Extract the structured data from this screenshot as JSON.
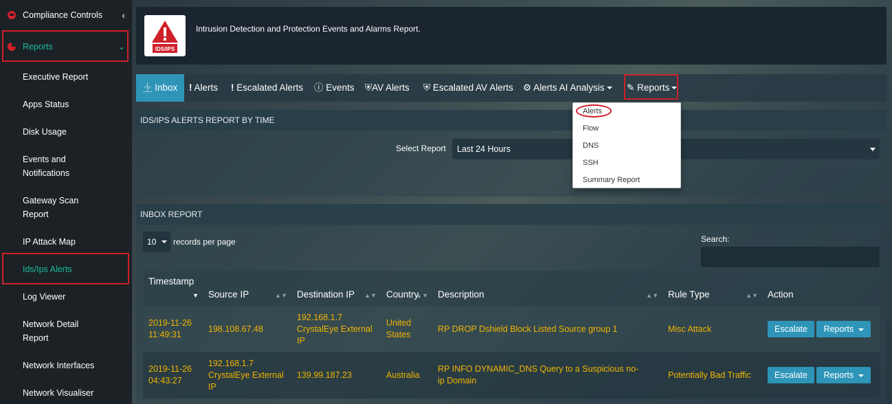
{
  "sidebar": {
    "compliance": "Compliance Controls",
    "reports": "Reports",
    "items": [
      {
        "label": "Executive Report"
      },
      {
        "label": "Apps Status"
      },
      {
        "label": "Disk Usage"
      },
      {
        "label": "Events and Notifications"
      },
      {
        "label": "Gateway Scan Report"
      },
      {
        "label": "IP Attack Map"
      },
      {
        "label": "Ids/Ips Alerts"
      },
      {
        "label": "Log Viewer"
      },
      {
        "label": "Network Detail Report"
      },
      {
        "label": "Network Interfaces"
      },
      {
        "label": "Network Visualiser"
      }
    ]
  },
  "header": {
    "logo_text": "IDS/IPS",
    "title": "Intrusion Detection and Protection Events and Alarms Report."
  },
  "tabs": [
    {
      "label": "Inbox"
    },
    {
      "label": "Alerts"
    },
    {
      "label": "Escalated Alerts"
    },
    {
      "label": "Events"
    },
    {
      "label": "AV Alerts"
    },
    {
      "label": "Escalated AV Alerts"
    },
    {
      "label": "Alerts AI Analysis"
    },
    {
      "label": "Reports"
    }
  ],
  "reports_menu": [
    "Alerts",
    "Flow",
    "DNS",
    "SSH",
    "Summary Report"
  ],
  "time_panel": {
    "title": "IDS/IPS ALERTS REPORT BY TIME",
    "select_label": "Select Report",
    "select_value": "Last 24 Hours"
  },
  "inbox": {
    "title": "INBOX REPORT",
    "length_value": "10",
    "length_suffix": "records per page",
    "search_label": "Search:",
    "columns": [
      "Timestamp",
      "Source IP",
      "Destination IP",
      "Country",
      "Description",
      "Rule Type",
      "Action"
    ],
    "rows": [
      {
        "timestamp_date": "2019-11-26",
        "timestamp_time": "11:49:31",
        "source_ip": "198.108.67.48",
        "dest_ip": "192.168.1.7",
        "dest_note": "CrystalEye External IP",
        "country": "United States",
        "description": "RP DROP Dshield Block Listed Source group 1",
        "rule_type": "Misc Attack",
        "escalate": "Escalate",
        "reports": "Reports"
      },
      {
        "timestamp_date": "2019-11-26",
        "timestamp_time": "04:43:27",
        "source_ip": "192.168.1.7",
        "source_note": "CrystalEye External IP",
        "dest_ip": "139.99.187.23",
        "country": "Australia",
        "description": "RP INFO DYNAMIC_DNS Query to a Suspicious no-ip Domain",
        "rule_type": "Potentially Bad Traffic",
        "escalate": "Escalate",
        "reports": "Reports"
      }
    ]
  },
  "colors": {
    "accent": "#2e95b8",
    "highlight": "#d0202a",
    "link": "#f0b400",
    "active_green": "#1abc9c"
  }
}
